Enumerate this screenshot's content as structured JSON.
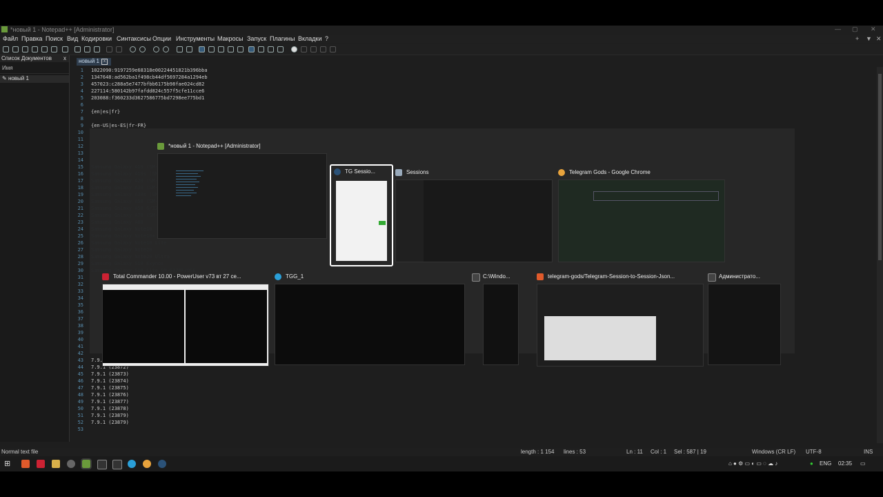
{
  "window": {
    "title": "*новый 1 - Notepad++ [Administrator]",
    "controls": [
      "—",
      "▢",
      "✕"
    ]
  },
  "menu": [
    "Файл",
    "Правка",
    "Поиск",
    "Вид",
    "Кодировки",
    "Синтаксисы",
    "Опции",
    "Инструменты",
    "Макросы",
    "Запуск",
    "Плагины",
    "Вкладки",
    "?"
  ],
  "doclist": {
    "title": "Список Документов",
    "close": "x",
    "column": "Имя",
    "items": [
      "новый 1"
    ]
  },
  "tabs": [
    {
      "label": "новый 1"
    }
  ],
  "editor": {
    "lines": [
      {
        "n": "1",
        "text": "1022090:9197259e68318e00224451821b396bba"
      },
      {
        "n": "2",
        "text": "1347648:ad562ba1f498cb44df5697284a1294eb"
      },
      {
        "n": "3",
        "text": "457023:c288a5e7477bfbb6175b98fae024cd82"
      },
      {
        "n": "4",
        "text": "227114:580142b97fafdd824c557f5cfe11cce6"
      },
      {
        "n": "5",
        "text": "203088:f360233d3627586775bd7298ee775bd1"
      },
      {
        "n": "6",
        "text": ""
      },
      {
        "n": "7",
        "text": "{en|es|fr}"
      },
      {
        "n": "8",
        "text": ""
      },
      {
        "n": "9",
        "text": "{en-US|es-ES|fr-FR}"
      },
      {
        "n": "10",
        "text": ""
      },
      {
        "n": "11",
        "text": ""
      },
      {
        "n": "12",
        "text": ""
      },
      {
        "n": "13",
        "text": ""
      },
      {
        "n": "14",
        "text": ""
      },
      {
        "n": "15",
        "text": ""
      },
      {
        "n": "16",
        "text": ""
      },
      {
        "n": "17",
        "text": ""
      },
      {
        "n": "18",
        "text": ""
      },
      {
        "n": "19",
        "text": ""
      },
      {
        "n": "20",
        "text": ""
      },
      {
        "n": "21",
        "text": ""
      },
      {
        "n": "22",
        "text": ""
      },
      {
        "n": "23",
        "text": ""
      },
      {
        "n": "24",
        "text": ""
      },
      {
        "n": "25",
        "text": ""
      },
      {
        "n": "26",
        "text": ""
      },
      {
        "n": "27",
        "text": ""
      },
      {
        "n": "28",
        "text": ""
      },
      {
        "n": "29",
        "text": ""
      },
      {
        "n": "30",
        "text": ""
      },
      {
        "n": "31",
        "text": ""
      },
      {
        "n": "32",
        "text": ""
      },
      {
        "n": "33",
        "text": ""
      },
      {
        "n": "34",
        "text": ""
      },
      {
        "n": "35",
        "text": ""
      },
      {
        "n": "36",
        "text": ""
      },
      {
        "n": "37",
        "text": ""
      },
      {
        "n": "38",
        "text": ""
      },
      {
        "n": "39",
        "text": ""
      },
      {
        "n": "40",
        "text": ""
      },
      {
        "n": "41",
        "text": ""
      },
      {
        "n": "42",
        "text": ""
      },
      {
        "n": "43",
        "text": "7.9.1 (23871)"
      },
      {
        "n": "44",
        "text": "7.9.1 (23872)"
      },
      {
        "n": "45",
        "text": "7.9.1 (23873)"
      },
      {
        "n": "46",
        "text": "7.9.1 (23874)"
      },
      {
        "n": "47",
        "text": "7.9.1 (23875)"
      },
      {
        "n": "48",
        "text": "7.9.1 (23876)"
      },
      {
        "n": "49",
        "text": "7.9.1 (23877)"
      },
      {
        "n": "50",
        "text": "7.9.1 (23878)"
      },
      {
        "n": "51",
        "text": "7.9.1 (23879)"
      },
      {
        "n": "52",
        "text": "7.9.1 (23879)"
      },
      {
        "n": "53",
        "text": ""
      }
    ],
    "faded_lines": [
      "Samsung Galaxy A10 (SM-A105F/DS)",
      "Samsung Galaxy A10s (SM-A107F)",
      "Samsung Galaxy A20 (SM-A205F)",
      "Samsung Galaxy A30 (SM-A305F)",
      "Samsung Galaxy A30s (SM-A307FN)",
      "Samsung Galaxy A50 (SM-A505F)",
      "Samsung Galaxy A50 6/128",
      "Samsung Galaxy A70 (SM-A705F)",
      "Samsung Galaxy A80",
      "Samsung Galaxy Note10",
      "Samsung Galaxy Note10+",
      "Samsung Galaxy Note10 Lite",
      "Samsung Galaxy Note20",
      "Samsung Galaxy Note20 Ultra",
      "Samsung Galaxy S10 Exynos",
      "Samsung Galaxy S10 Lite SM-G770F/DSE"
    ]
  },
  "statusbar": {
    "type": "Normal text file",
    "length": "length : 1 154",
    "lines": "lines : 53",
    "ln": "Ln : 11",
    "col": "Col : 1",
    "sel": "Sel : 587 | 19",
    "eol": "Windows (CR LF)",
    "enc": "UTF-8",
    "ins": "INS"
  },
  "taskbar": {
    "lang": "ENG",
    "time": "02:35"
  },
  "alttab": {
    "row1": [
      {
        "label": "*новый 1 - Notepad++ [Administrator]",
        "icon_color": "#6a9a3b",
        "selected": false
      },
      {
        "label": "TG Sessio...",
        "icon_color": "#2b5278",
        "selected": true
      },
      {
        "label": "Sessions",
        "icon_color": "#9ab",
        "selected": false
      },
      {
        "label": "Telegram Gods - Google Chrome",
        "icon_color": "#e8a33c",
        "selected": false
      }
    ],
    "row2": [
      {
        "label": "Total Commander 10.00 - PowerUser v73    вт 27 се...",
        "icon_color": "#c23",
        "selected": false
      },
      {
        "label": "TGG_1",
        "icon_color": "#2a9fd8",
        "selected": false
      },
      {
        "label": "C:\\Windo...",
        "icon_color": "#444",
        "selected": false
      },
      {
        "label": "telegram-gods/Telegram-Session-to-Session-Json...",
        "icon_color": "#e05a2b",
        "selected": false
      },
      {
        "label": "Администрато...",
        "icon_color": "#444",
        "selected": false
      }
    ]
  }
}
